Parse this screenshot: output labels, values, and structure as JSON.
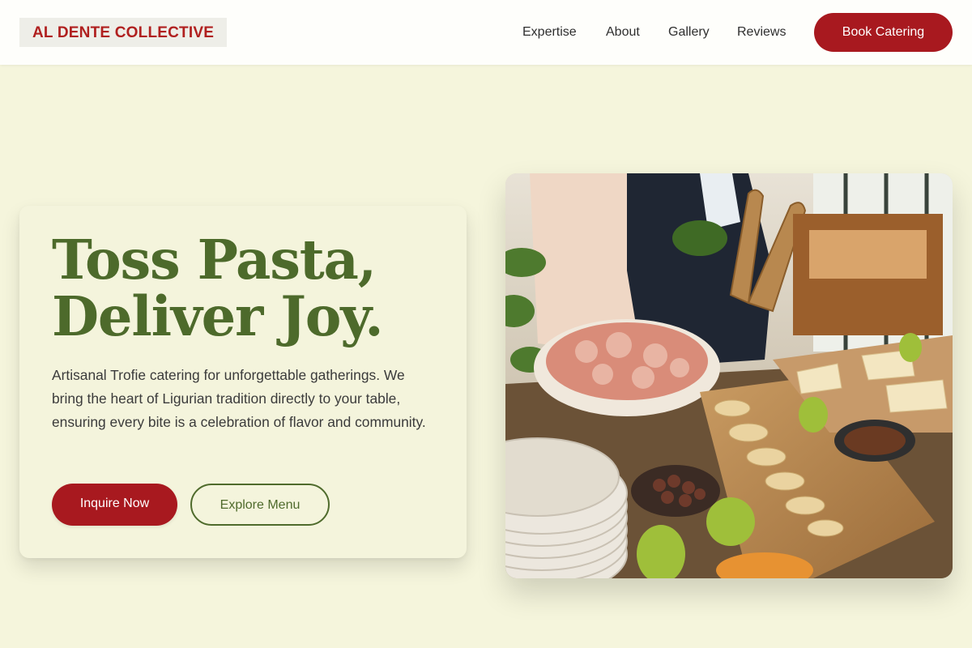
{
  "brand": {
    "name": "AL DENTE COLLECTIVE"
  },
  "nav": {
    "links": [
      "Expertise",
      "About",
      "Gallery",
      "Reviews"
    ],
    "cta": "Book Catering"
  },
  "hero": {
    "headline_line1": "Toss Pasta,",
    "headline_line2": "Deliver Joy.",
    "description": "Artisanal Trofie catering for unforgettable gatherings. We bring the heart of Ligurian tradition directly to your table, ensuring every bite is a celebration of flavor and community.",
    "primary_button": "Inquire Now",
    "secondary_button": "Explore Menu"
  },
  "colors": {
    "background": "#f5f5dc",
    "accent_red": "#a8191f",
    "accent_green": "#4d6a2b"
  }
}
